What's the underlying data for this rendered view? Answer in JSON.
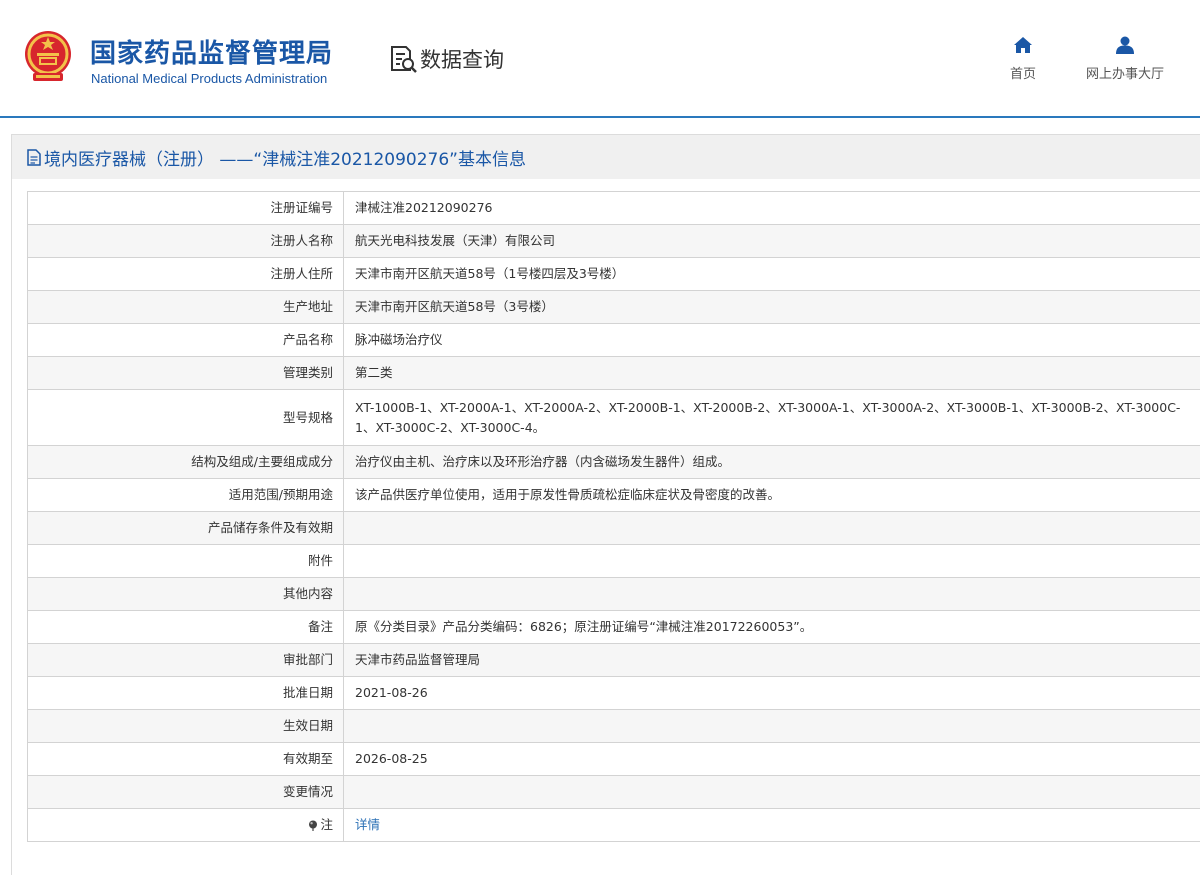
{
  "header": {
    "org_cn": "国家药品监督管理局",
    "org_en": "National Medical Products Administration",
    "query_title": "数据查询",
    "nav": [
      {
        "label": "首页",
        "icon": "home-icon"
      },
      {
        "label": "网上办事大厅",
        "icon": "user-icon"
      }
    ]
  },
  "panel": {
    "title": "境内医疗器械（注册） ——“津械注准20212090276”基本信息"
  },
  "rows": [
    {
      "label": "注册证编号",
      "value": "津械注准20212090276"
    },
    {
      "label": "注册人名称",
      "value": "航天光电科技发展（天津）有限公司"
    },
    {
      "label": "注册人住所",
      "value": "天津市南开区航天道58号（1号楼四层及3号楼）"
    },
    {
      "label": "生产地址",
      "value": "天津市南开区航天道58号（3号楼）"
    },
    {
      "label": "产品名称",
      "value": "脉冲磁场治疗仪"
    },
    {
      "label": "管理类别",
      "value": "第二类"
    },
    {
      "label": "型号规格",
      "value": "XT-1000B-1、XT-2000A-1、XT-2000A-2、XT-2000B-1、XT-2000B-2、XT-3000A-1、XT-3000A-2、XT-3000B-1、XT-3000B-2、XT-3000C-1、XT-3000C-2、XT-3000C-4。"
    },
    {
      "label": "结构及组成/主要组成成分",
      "value": "治疗仪由主机、治疗床以及环形治疗器（内含磁场发生器件）组成。"
    },
    {
      "label": "适用范围/预期用途",
      "value": "该产品供医疗单位使用，适用于原发性骨质疏松症临床症状及骨密度的改善。"
    },
    {
      "label": "产品储存条件及有效期",
      "value": ""
    },
    {
      "label": "附件",
      "value": ""
    },
    {
      "label": "其他内容",
      "value": ""
    },
    {
      "label": "备注",
      "value": "原《分类目录》产品分类编码：6826；原注册证编号“津械注准20172260053”。"
    },
    {
      "label": "审批部门",
      "value": "天津市药品监督管理局"
    },
    {
      "label": "批准日期",
      "value": "2021-08-26"
    },
    {
      "label": "生效日期",
      "value": ""
    },
    {
      "label": "有效期至",
      "value": "2026-08-25"
    },
    {
      "label": "变更情况",
      "value": ""
    },
    {
      "label": "注",
      "value": "详情"
    }
  ]
}
